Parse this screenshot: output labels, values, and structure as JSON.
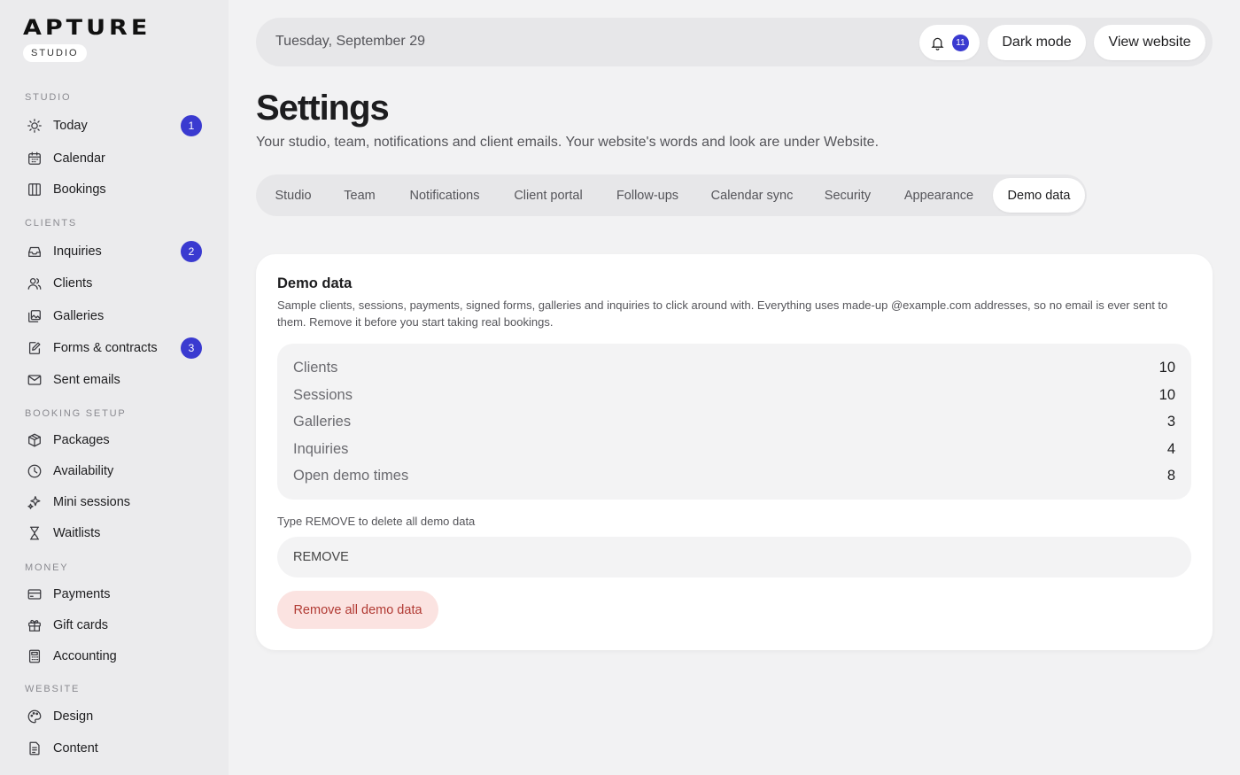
{
  "brand": {
    "logo": "APTURE",
    "tag": "STUDIO"
  },
  "sidebar": {
    "sections": [
      {
        "label": "STUDIO"
      },
      {
        "label": "CLIENTS"
      },
      {
        "label": "BOOKING SETUP"
      },
      {
        "label": "MONEY"
      },
      {
        "label": "WEBSITE"
      }
    ],
    "items": [
      {
        "label": "Today",
        "icon": "sun-icon",
        "badge": "1"
      },
      {
        "label": "Calendar",
        "icon": "calendar-icon"
      },
      {
        "label": "Bookings",
        "icon": "columns-icon"
      },
      {
        "label": "Inquiries",
        "icon": "inbox-icon",
        "badge": "2"
      },
      {
        "label": "Clients",
        "icon": "users-icon"
      },
      {
        "label": "Galleries",
        "icon": "images-icon"
      },
      {
        "label": "Forms & contracts",
        "icon": "pen-document-icon",
        "badge": "3"
      },
      {
        "label": "Sent emails",
        "icon": "mail-icon"
      },
      {
        "label": "Packages",
        "icon": "package-icon"
      },
      {
        "label": "Availability",
        "icon": "clock-icon"
      },
      {
        "label": "Mini sessions",
        "icon": "sparkles-icon"
      },
      {
        "label": "Waitlists",
        "icon": "hourglass-icon"
      },
      {
        "label": "Payments",
        "icon": "credit-card-icon"
      },
      {
        "label": "Gift cards",
        "icon": "gift-icon"
      },
      {
        "label": "Accounting",
        "icon": "calculator-icon"
      },
      {
        "label": "Design",
        "icon": "palette-icon"
      },
      {
        "label": "Content",
        "icon": "document-icon"
      }
    ]
  },
  "topbar": {
    "date": "Tuesday, September 29",
    "notification_count": "11",
    "dark_mode_label": "Dark mode",
    "view_website_label": "View website"
  },
  "page": {
    "title": "Settings",
    "subtitle": "Your studio, team, notifications and client emails. Your website's words and look are under Website."
  },
  "tabs": [
    {
      "label": "Studio"
    },
    {
      "label": "Team"
    },
    {
      "label": "Notifications"
    },
    {
      "label": "Client portal"
    },
    {
      "label": "Follow-ups"
    },
    {
      "label": "Calendar sync"
    },
    {
      "label": "Security"
    },
    {
      "label": "Appearance"
    },
    {
      "label": "Demo data",
      "active": true
    }
  ],
  "demo": {
    "title": "Demo data",
    "description": "Sample clients, sessions, payments, signed forms, galleries and inquiries to click around with. Everything uses made-up @example.com addresses, so no email is ever sent to them. Remove it before you start taking real bookings.",
    "stats": [
      {
        "label": "Clients",
        "value": "10"
      },
      {
        "label": "Sessions",
        "value": "10"
      },
      {
        "label": "Galleries",
        "value": "3"
      },
      {
        "label": "Inquiries",
        "value": "4"
      },
      {
        "label": "Open demo times",
        "value": "8"
      }
    ],
    "confirm_label": "Type REMOVE to delete all demo data",
    "confirm_value": "REMOVE",
    "remove_button": "Remove all demo data"
  },
  "colors": {
    "accent": "#3a3ad0",
    "danger_text": "#b13a33",
    "danger_bg": "#fbe3e1"
  }
}
